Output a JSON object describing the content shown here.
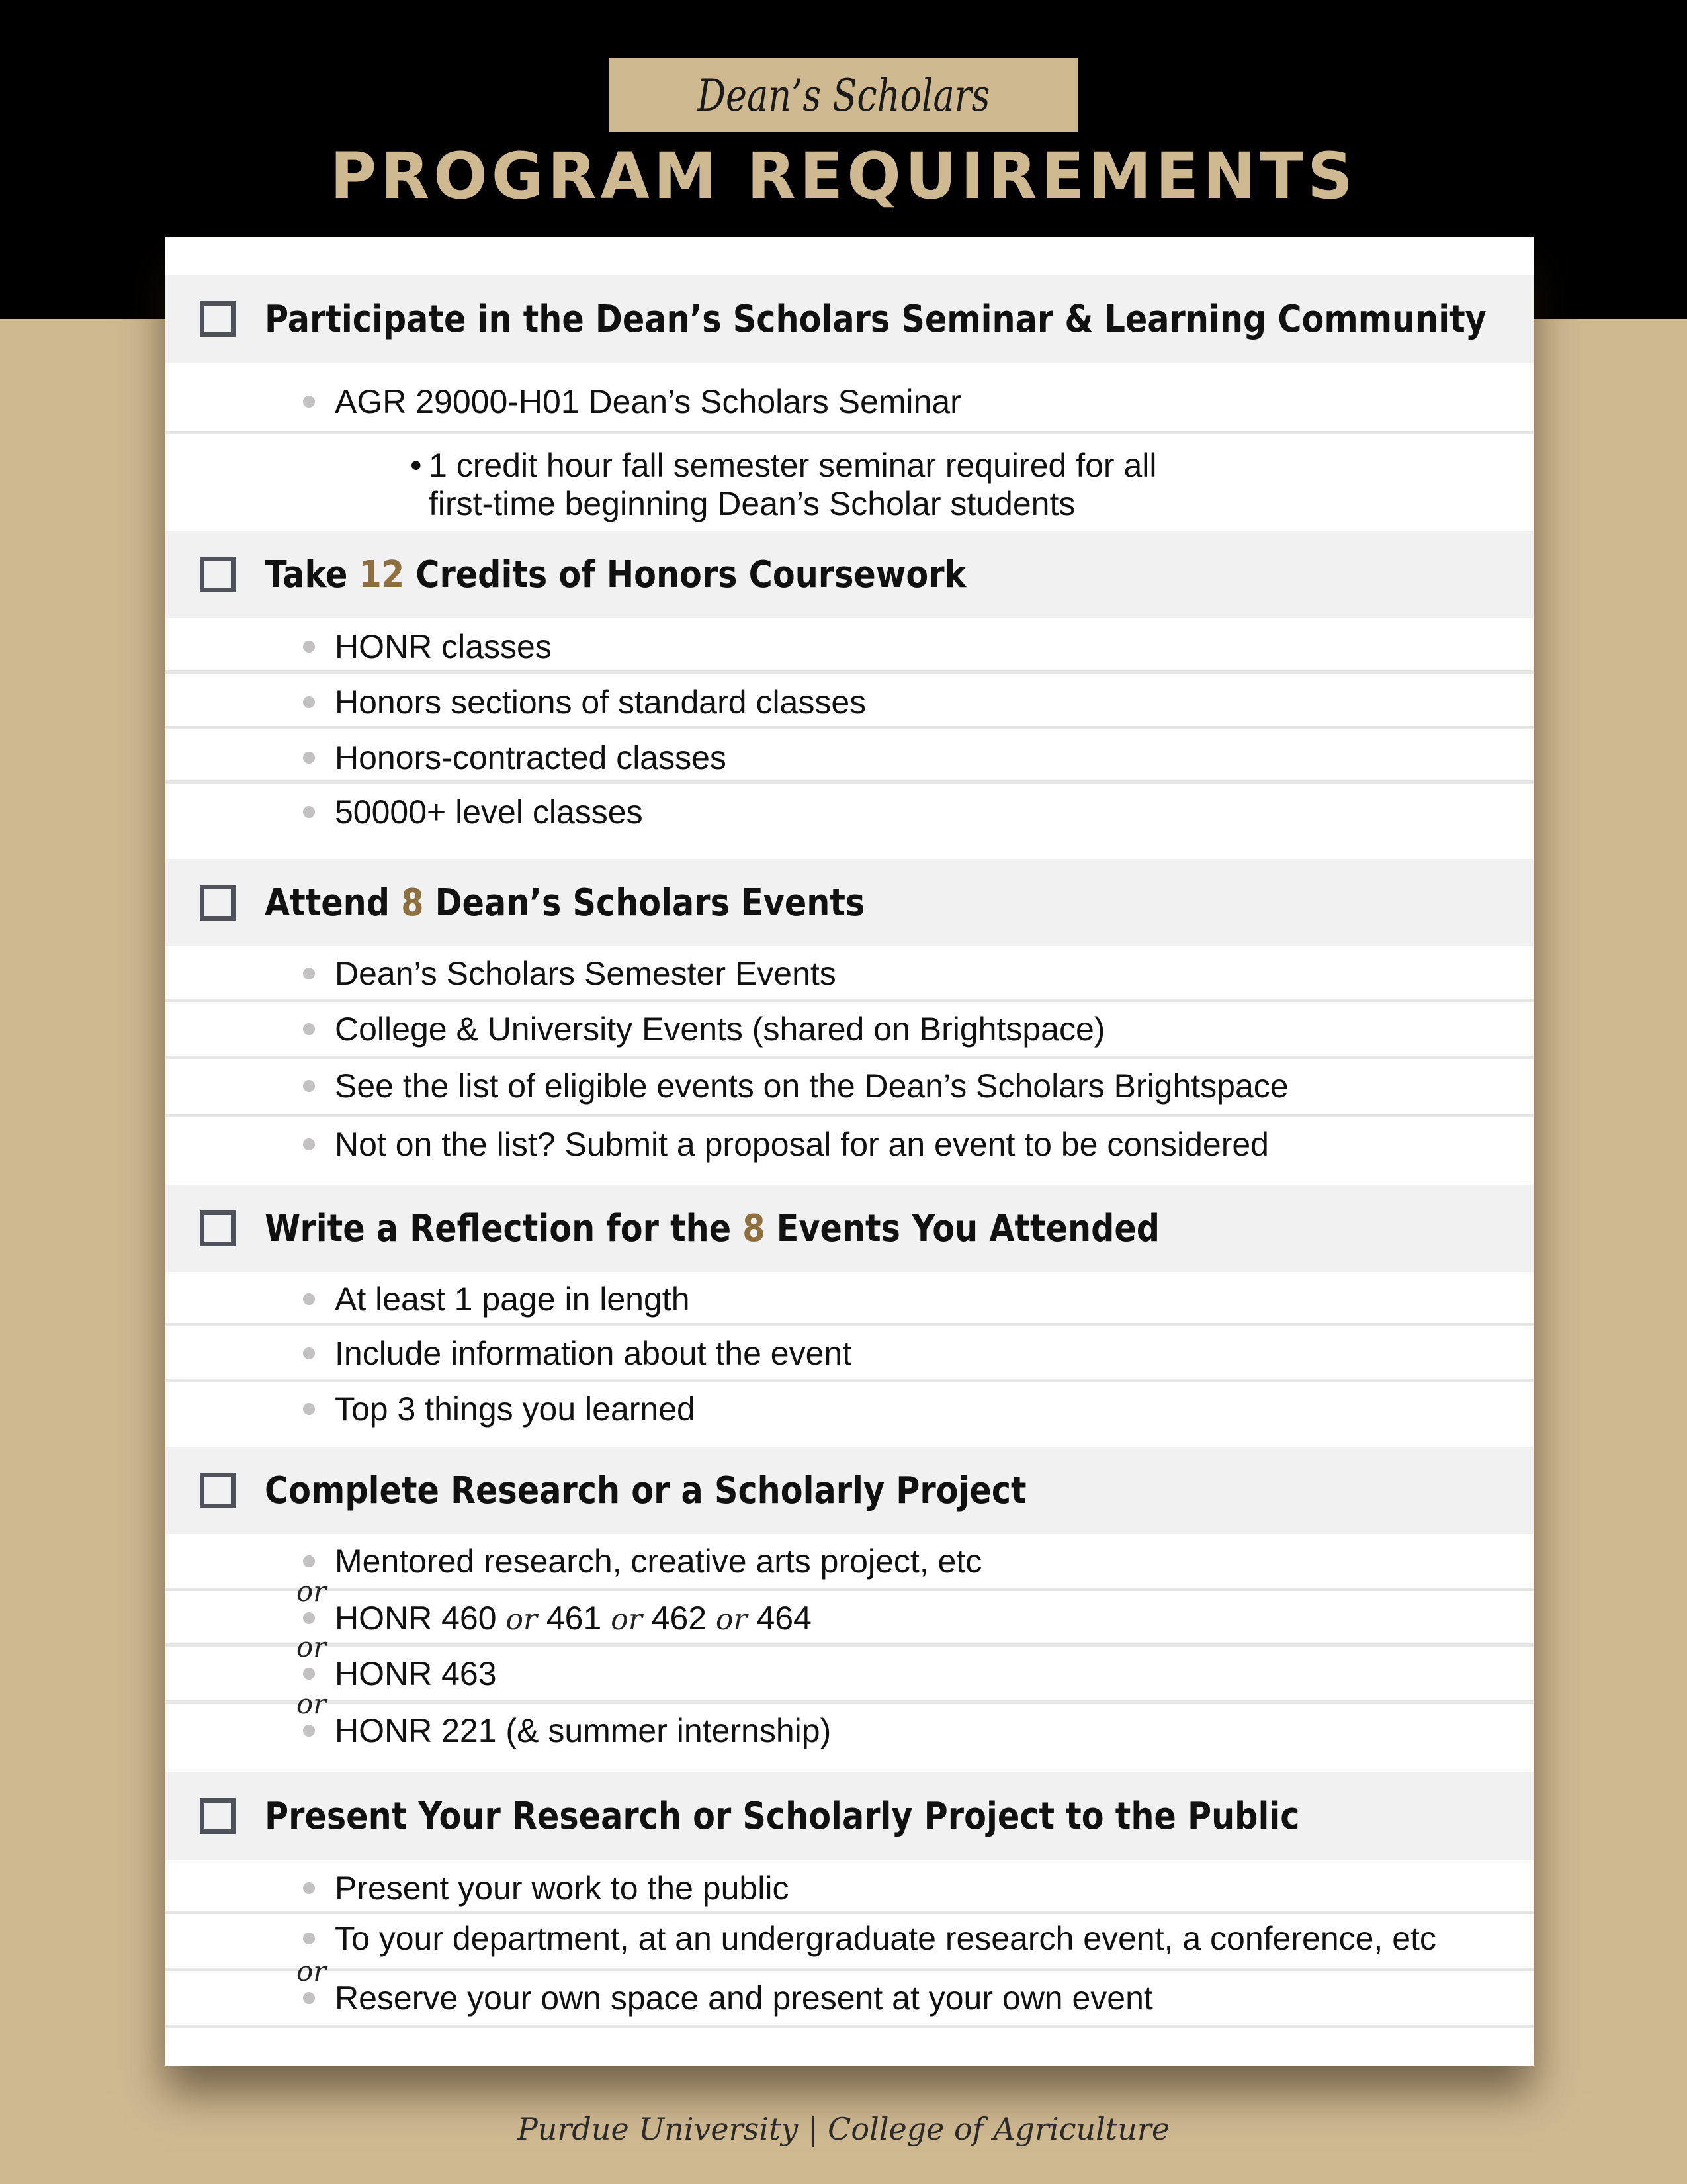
{
  "header": {
    "badge": "Dean’s Scholars",
    "title": "PROGRAM REQUIREMENTS"
  },
  "colors": {
    "black": "#000000",
    "gold": "#CFB991",
    "accent": "#8E6F3E",
    "section_bg": "#F1F1F1"
  },
  "sections": [
    {
      "title_pre": "Participate in the Dean’s Scholars Seminar & Learning Community",
      "items": [
        "AGR 29000-H01 Dean’s Scholars Seminar"
      ],
      "sub_items": [
        "1 credit hour fall semester seminar required for all",
        "first-time beginning Dean’s Scholar students"
      ]
    },
    {
      "title_pre": "Take ",
      "title_num": "12",
      "title_post": " Credits of Honors Coursework",
      "items": [
        "HONR classes",
        "Honors sections of standard classes",
        "Honors-contracted classes",
        "50000+ level classes"
      ]
    },
    {
      "title_pre": "Attend ",
      "title_num": "8",
      "title_post": " Dean’s Scholars Events",
      "items": [
        "Dean’s Scholars Semester Events",
        "College & University Events (shared on Brightspace)",
        "See the list of eligible events on the Dean’s Scholars Brightspace",
        "Not on the list? Submit a proposal for an event to be considered"
      ]
    },
    {
      "title_pre": "Write a Reflection for the ",
      "title_num": "8",
      "title_post": " Events You Attended",
      "items": [
        "At least 1 page in length",
        "Include information about the event",
        "Top 3 things you learned"
      ]
    },
    {
      "title_pre": "Complete Research or a Scholarly Project",
      "items": [
        "Mentored research, creative arts project, etc",
        "HONR 460",
        "461",
        "462",
        "464",
        "HONR 463",
        "HONR 221 (& summer internship)"
      ],
      "or": "or"
    },
    {
      "title_pre": "Present Your Research or Scholarly Project to the Public",
      "items": [
        "Present your work to the public",
        "To your department, at an undergraduate research event, a conference, etc",
        "Reserve your own space and present at your own event"
      ],
      "or": "or"
    }
  ],
  "footer": "Purdue University | College of Agriculture"
}
